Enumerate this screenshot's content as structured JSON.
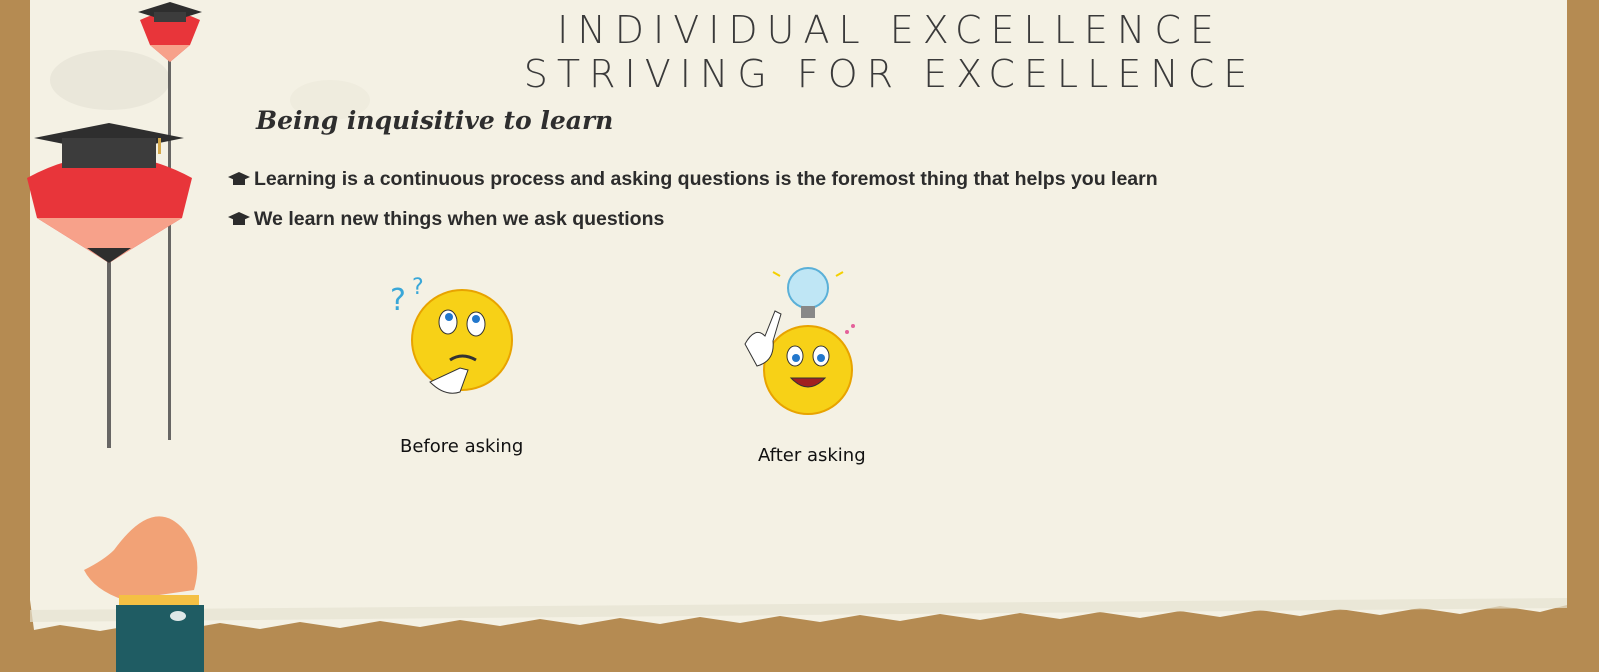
{
  "slide": {
    "title_line1": "INDIVIDUAL EXCELLENCE",
    "title_line2": "STRIVING FOR EXCELLENCE",
    "subtitle": "Being inquisitive to learn",
    "bullets": [
      {
        "text": "Learning is a continuous process and asking questions is the foremost thing that helps you learn",
        "icon": "graduation-cap-icon"
      },
      {
        "text": "We learn new things when we ask questions",
        "icon": "graduation-cap-icon"
      }
    ],
    "images": [
      {
        "caption": "Before asking",
        "icon": "thinking-smiley-icon"
      },
      {
        "caption": "After asking",
        "icon": "idea-smiley-icon"
      }
    ]
  },
  "colors": {
    "frame": "#b58b52",
    "paper": "#f4f1e4",
    "balloon_red": "#e8353a",
    "balloon_pink": "#f7a18a",
    "smiley_yellow": "#f7d117"
  }
}
